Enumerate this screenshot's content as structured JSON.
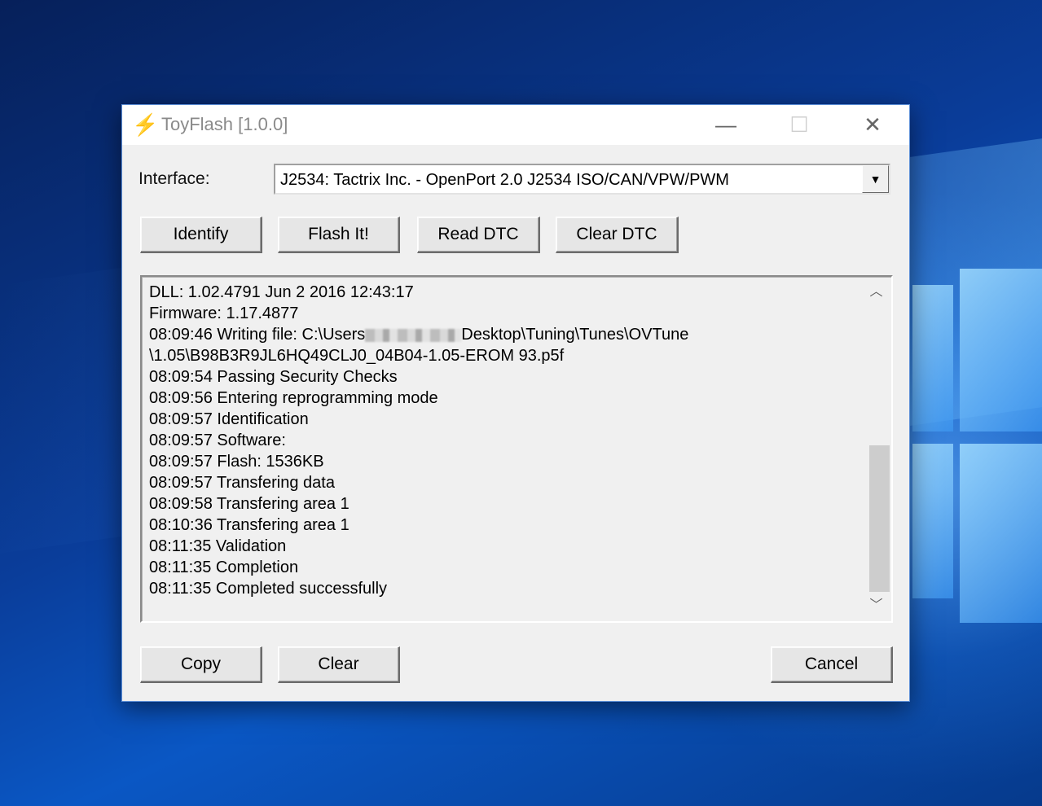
{
  "window": {
    "title": "ToyFlash [1.0.0]",
    "controls": {
      "minimize": "—",
      "maximize": "☐",
      "close": "✕"
    }
  },
  "interface": {
    "label": "Interface:",
    "selected": "J2534: Tactrix Inc. - OpenPort 2.0 J2534 ISO/CAN/VPW/PWM"
  },
  "actions": {
    "identify": "Identify",
    "flash": "Flash It!",
    "read_dtc": "Read DTC",
    "clear_dtc": "Clear DTC"
  },
  "log": {
    "lines": [
      "DLL: 1.02.4791 Jun  2 2016 12:43:17",
      "Firmware: 1.17.4877",
      "08:09:46 Writing file: C:\\Users",
      "Desktop\\Tuning\\Tunes\\OVTune",
      "\\1.05\\B98B3R9JL6HQ49CLJ0_04B04-1.05-EROM 93.p5f",
      "08:09:54 Passing Security Checks",
      "08:09:56 Entering reprogramming mode",
      "08:09:57 Identification",
      "08:09:57 Software:",
      "08:09:57 Flash: 1536KB",
      "08:09:57 Transfering data",
      "08:09:58 Transfering area 1",
      "08:10:36 Transfering area 1",
      "08:11:35 Validation",
      "08:11:35 Completion",
      "08:11:35 Completed successfully"
    ],
    "scroll_position": 0.62
  },
  "footer": {
    "copy": "Copy",
    "clear": "Clear",
    "cancel": "Cancel"
  },
  "icons": {
    "app": "lightning-bolt-icon",
    "dropdown": "chevron-down-icon",
    "scroll_up": "chevron-up-icon",
    "scroll_down": "chevron-down-icon"
  },
  "colors": {
    "desktop_blue": "#0a57c4",
    "window_bg": "#f0f0f0",
    "title_text": "#8a8a8a"
  }
}
